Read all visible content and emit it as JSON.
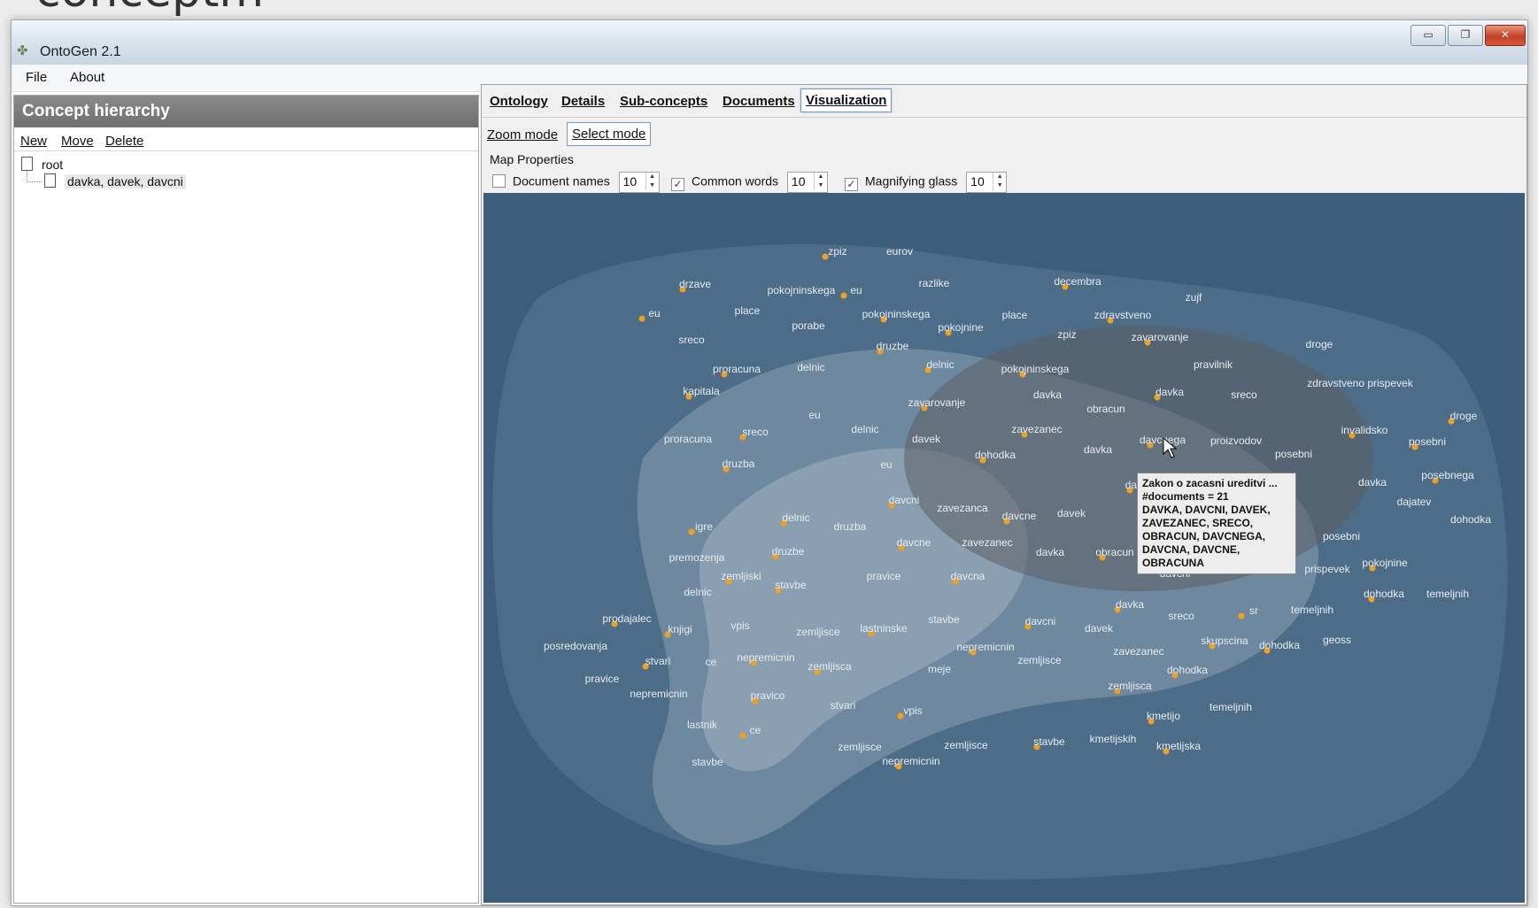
{
  "slide": {
    "heading": "conceptm"
  },
  "window": {
    "title": "OntoGen 2.1",
    "controls": {
      "minimize": "▭",
      "maximize": "❐",
      "close": "✕"
    }
  },
  "menu": {
    "file": "File",
    "about": "About"
  },
  "left": {
    "header": "Concept hierarchy",
    "tools": {
      "new": "New",
      "move": "Move",
      "delete": "Delete"
    },
    "tree": {
      "root": "root",
      "child": "davka, davek, davcni"
    }
  },
  "right": {
    "tabs": {
      "ontology": "Ontology",
      "details": "Details",
      "subconcepts": "Sub-concepts",
      "documents": "Documents",
      "visualization": "Visualization"
    },
    "modes": {
      "zoom": "Zoom mode",
      "select": "Select mode"
    },
    "props": {
      "title": "Map Properties",
      "document_names": {
        "label": "Document names",
        "checked": false,
        "value": "10"
      },
      "common_words": {
        "label": "Common words",
        "checked": true,
        "value": "10"
      },
      "magnifying_glass": {
        "label": "Magnifying glass",
        "checked": true,
        "value": "10"
      }
    }
  },
  "map": {
    "colors": {
      "bg": "#3d5d7a",
      "dot": "#f0a020",
      "label": "#e6ecf2"
    },
    "words": [
      [
        "zpiz",
        945,
        282
      ],
      [
        "eurov",
        1015,
        282
      ],
      [
        "drzave",
        784,
        319
      ],
      [
        "pokojninskega",
        904,
        326
      ],
      [
        "eu",
        966,
        326
      ],
      [
        "razlike",
        1054,
        318
      ],
      [
        "decembra",
        1216,
        316
      ],
      [
        "zujf",
        1347,
        334
      ],
      [
        "eu",
        738,
        352
      ],
      [
        "place",
        843,
        349
      ],
      [
        "pokojninskega",
        1011,
        353
      ],
      [
        "place",
        1145,
        354
      ],
      [
        "zdravstveno",
        1267,
        354
      ],
      [
        "porabe",
        912,
        366
      ],
      [
        "pokojnine",
        1084,
        368
      ],
      [
        "zpiz",
        1204,
        376
      ],
      [
        "zavarovanje",
        1309,
        379
      ],
      [
        "sreco",
        780,
        382
      ],
      [
        "druzbe",
        1007,
        389
      ],
      [
        "droge",
        1489,
        387
      ],
      [
        "delnic",
        1061,
        410
      ],
      [
        "pravilnik",
        1369,
        410
      ],
      [
        "proracuna",
        831,
        415
      ],
      [
        "delnic",
        915,
        413
      ],
      [
        "pokojninskega",
        1168,
        415
      ],
      [
        "zdravstveno prispevek",
        1535,
        431
      ],
      [
        "kapitala",
        791,
        440
      ],
      [
        "davka",
        1182,
        444
      ],
      [
        "davka",
        1320,
        441
      ],
      [
        "sreco",
        1404,
        444
      ],
      [
        "zavarovanje",
        1057,
        453
      ],
      [
        "obracun",
        1248,
        460
      ],
      [
        "droge",
        1652,
        468
      ],
      [
        "eu",
        919,
        467
      ],
      [
        "sreco",
        852,
        486
      ],
      [
        "delnic",
        976,
        483
      ],
      [
        "zavezanec",
        1170,
        483
      ],
      [
        "davek",
        1045,
        494
      ],
      [
        "invalidsko",
        1540,
        484
      ],
      [
        "proracuna",
        776,
        494
      ],
      [
        "davcnega",
        1312,
        495
      ],
      [
        "proizvodov",
        1395,
        496
      ],
      [
        "posebni",
        1611,
        497
      ],
      [
        "davka",
        1239,
        506
      ],
      [
        "dohodka",
        1123,
        512
      ],
      [
        "posebni",
        1460,
        511
      ],
      [
        "druzba",
        833,
        522
      ],
      [
        "eu",
        1000,
        523
      ],
      [
        "posebnega",
        1634,
        535
      ],
      [
        "davka",
        1549,
        543
      ],
      [
        "davcne",
        1289,
        546
      ],
      [
        "dajatev",
        1596,
        565
      ],
      [
        "davcni",
        1020,
        563
      ],
      [
        "zavezanca",
        1086,
        572
      ],
      [
        "davcne",
        1150,
        581
      ],
      [
        "davek",
        1209,
        578
      ],
      [
        "sreco",
        1315,
        586
      ],
      [
        "dohodka",
        1660,
        585
      ],
      [
        "delnic",
        898,
        583
      ],
      [
        "druzba",
        959,
        593
      ],
      [
        "igre",
        794,
        593
      ],
      [
        "posebni",
        1514,
        604
      ],
      [
        "davcne",
        1031,
        611
      ],
      [
        "zavezanec",
        1114,
        611
      ],
      [
        "druzbe",
        889,
        621
      ],
      [
        "davka",
        1185,
        622
      ],
      [
        "obracun",
        1258,
        622
      ],
      [
        "premozenja",
        786,
        628
      ],
      [
        "pokojnine",
        1563,
        634
      ],
      [
        "prispevek",
        1498,
        641
      ],
      [
        "zemljiski",
        836,
        649
      ],
      [
        "pravice",
        997,
        649
      ],
      [
        "davcna",
        1092,
        649
      ],
      [
        "davcni",
        1326,
        646
      ],
      [
        "stavbe",
        892,
        659
      ],
      [
        "delnic",
        787,
        667
      ],
      [
        "dohodka",
        1562,
        669
      ],
      [
        "temeljnih",
        1634,
        669
      ],
      [
        "davka",
        1275,
        681
      ],
      [
        "temeljnih",
        1481,
        687
      ],
      [
        "sr",
        1415,
        688
      ],
      [
        "sreco",
        1333,
        694
      ],
      [
        "prodajalec",
        707,
        697
      ],
      [
        "stavbe",
        1065,
        698
      ],
      [
        "davcni",
        1174,
        700
      ],
      [
        "davek",
        1240,
        708
      ],
      [
        "lastninske",
        997,
        708
      ],
      [
        "vpis",
        835,
        705
      ],
      [
        "knjigi",
        767,
        709
      ],
      [
        "zemljisce",
        923,
        712
      ],
      [
        "skupscina",
        1382,
        722
      ],
      [
        "geoss",
        1509,
        721
      ],
      [
        "dohodka",
        1444,
        727
      ],
      [
        "posredovanja",
        649,
        728
      ],
      [
        "nepremicnin",
        1112,
        729
      ],
      [
        "zavezanec",
        1285,
        734
      ],
      [
        "nepremicnin",
        864,
        741
      ],
      [
        "ce",
        802,
        746
      ],
      [
        "stvari",
        742,
        745
      ],
      [
        "zemljisce",
        1173,
        744
      ],
      [
        "zemljisca",
        936,
        751
      ],
      [
        "meje",
        1060,
        754
      ],
      [
        "dohodka",
        1340,
        755
      ],
      [
        "pravice",
        679,
        765
      ],
      [
        "zemljisca",
        1275,
        773
      ],
      [
        "nepremicnin",
        743,
        782
      ],
      [
        "pravico",
        866,
        784
      ],
      [
        "stvari",
        951,
        795
      ],
      [
        "vpis",
        1030,
        801
      ],
      [
        "temeljnih",
        1389,
        797
      ],
      [
        "kmetijo",
        1313,
        807
      ],
      [
        "lastnik",
        792,
        817
      ],
      [
        "ce",
        852,
        823
      ],
      [
        "kmetijskih",
        1256,
        833
      ],
      [
        "kmetijska",
        1330,
        841
      ],
      [
        "zemljisce",
        1090,
        840
      ],
      [
        "stavbe",
        1184,
        836
      ],
      [
        "zemljisce",
        970,
        842
      ],
      [
        "nepremicnin",
        1028,
        858
      ],
      [
        "stavbe",
        798,
        859
      ]
    ],
    "tooltip": {
      "title": "Zakon o zacasni ureditvi ...",
      "count": "#documents = 21",
      "keywords": "DAVKA, DAVCNI, DAVEK,\nZAVEZANEC, SRECO,\nOBRACUN, DAVCNEGA,\nDAVCNA, DAVCNE,\nOBRACUNA"
    }
  }
}
